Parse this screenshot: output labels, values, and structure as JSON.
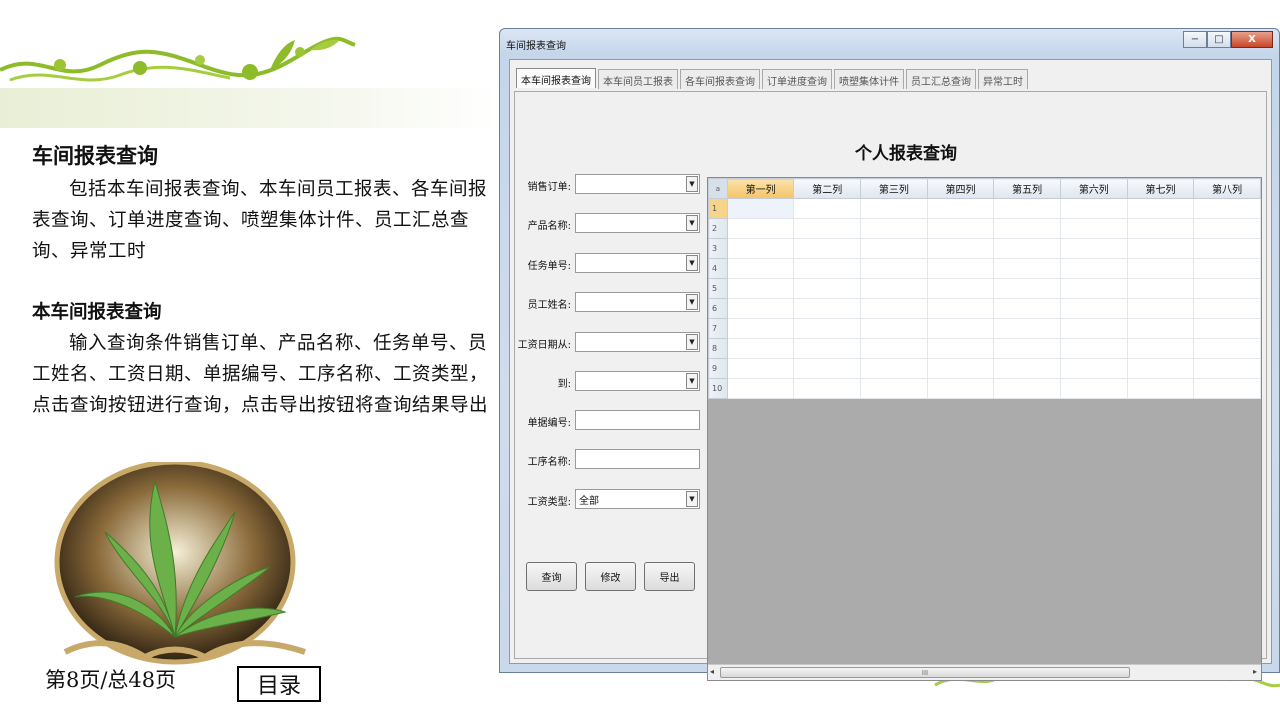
{
  "slide": {
    "title": "车间报表查询",
    "para1": "包括本车间报表查询、本车间员工报表、各车间报表查询、订单进度查询、喷塑集体计件、员工汇总查询、异常工时",
    "subtitle": "本车间报表查询",
    "para2": "输入查询条件销售订单、产品名称、任务单号、员工姓名、工资日期、单据编号、工序名称、工资类型，点击查询按钮进行查询，点击导出按钮将查询结果导出",
    "page_indicator": "第8页/总48页",
    "toc_button": "目录"
  },
  "window": {
    "title": "车间报表查询",
    "controls": {
      "minimize": "−",
      "maximize": "□",
      "close": "X"
    },
    "tabs": [
      "本车间报表查询",
      "本车间员工报表",
      "各车间报表查询",
      "订单进度查询",
      "喷塑集体计件",
      "员工汇总查询",
      "异常工时"
    ],
    "active_tab": 0,
    "report_title": "个人报表查询",
    "fields": [
      {
        "label": "销售订单:",
        "type": "combo",
        "value": ""
      },
      {
        "label": "产品名称:",
        "type": "combo",
        "value": ""
      },
      {
        "label": "任务单号:",
        "type": "combo",
        "value": ""
      },
      {
        "label": "员工姓名:",
        "type": "combo",
        "value": ""
      },
      {
        "label": "工资日期从:",
        "type": "combo",
        "value": ""
      },
      {
        "label": "到:",
        "type": "combo",
        "value": ""
      },
      {
        "label": "单据编号:",
        "type": "text",
        "value": ""
      },
      {
        "label": "工序名称:",
        "type": "text",
        "value": ""
      },
      {
        "label": "工资类型:",
        "type": "combo",
        "value": "全部"
      }
    ],
    "buttons": {
      "query": "查询",
      "modify": "修改",
      "export": "导出"
    },
    "grid": {
      "corner": "a",
      "columns": [
        "第一列",
        "第二列",
        "第三列",
        "第四列",
        "第五列",
        "第六列",
        "第七列",
        "第八列"
      ],
      "rows": [
        "1",
        "2",
        "3",
        "4",
        "5",
        "6",
        "7",
        "8",
        "9",
        "10"
      ],
      "selected_column": 0,
      "selected_row": 0,
      "scroll_thumb": "III"
    }
  },
  "colors": {
    "accent_green": "#8dbb2a",
    "window_frame": "#c5d6ea",
    "selected_header": "#f4c46a"
  }
}
